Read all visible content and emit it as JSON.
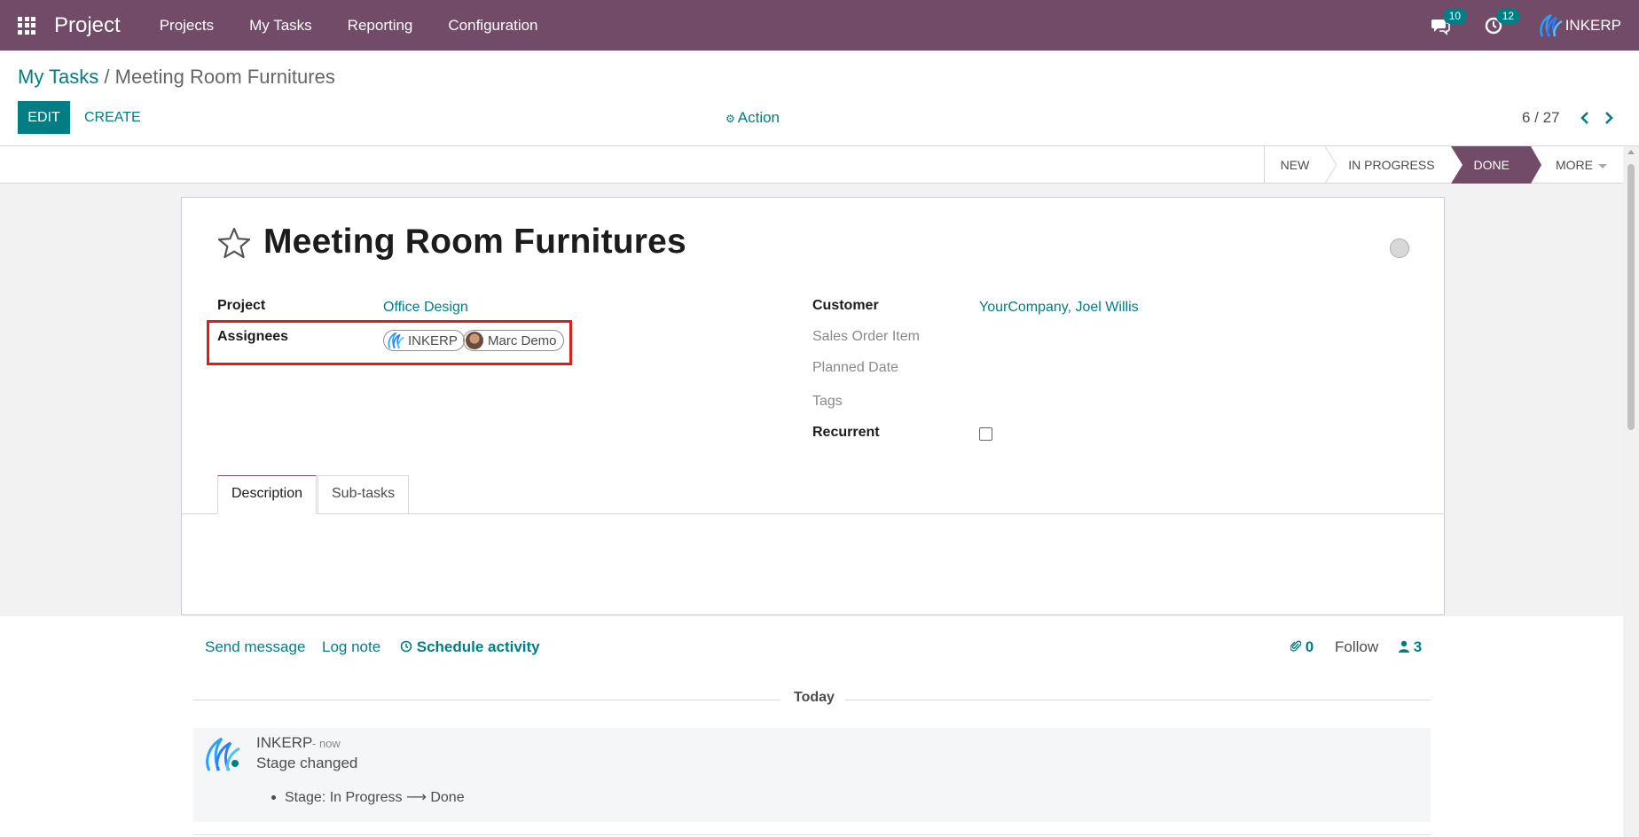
{
  "navbar": {
    "brand": "Project",
    "items": [
      "Projects",
      "My Tasks",
      "Reporting",
      "Configuration"
    ],
    "messages_count": "10",
    "activities_count": "12",
    "user": "INKERP"
  },
  "breadcrumb": {
    "parent": "My Tasks",
    "separator": " / ",
    "current": "Meeting Room Furnitures"
  },
  "toolbar": {
    "edit": "EDIT",
    "create": "CREATE",
    "action": "Action",
    "pager": "6 / 27"
  },
  "stages": {
    "new": "NEW",
    "in_progress": "IN PROGRESS",
    "done": "DONE",
    "more": "MORE",
    "current": "DONE"
  },
  "task": {
    "title": "Meeting Room Furnitures",
    "project_label": "Project",
    "project": "Office Design",
    "assignees_label": "Assignees",
    "assignees": [
      "INKERP",
      "Marc Demo"
    ],
    "customer_label": "Customer",
    "customer": "YourCompany, Joel Willis",
    "sales_order_label": "Sales Order Item",
    "planned_date_label": "Planned Date",
    "tags_label": "Tags",
    "recurrent_label": "Recurrent",
    "recurrent": false
  },
  "tabs": [
    "Description",
    "Sub-tasks"
  ],
  "chatter": {
    "send_message": "Send message",
    "log_note": "Log note",
    "schedule_activity": "Schedule activity",
    "attachments": "0",
    "follow": "Follow",
    "followers": "3",
    "date_separator": "Today",
    "message": {
      "author": "INKERP",
      "time": "- now",
      "body": "Stage changed",
      "tracking": "Stage: In Progress ⟶ Done"
    }
  },
  "colors": {
    "navbar": "#714b67",
    "primary": "#017e84",
    "highlight": "#e01b1b"
  }
}
